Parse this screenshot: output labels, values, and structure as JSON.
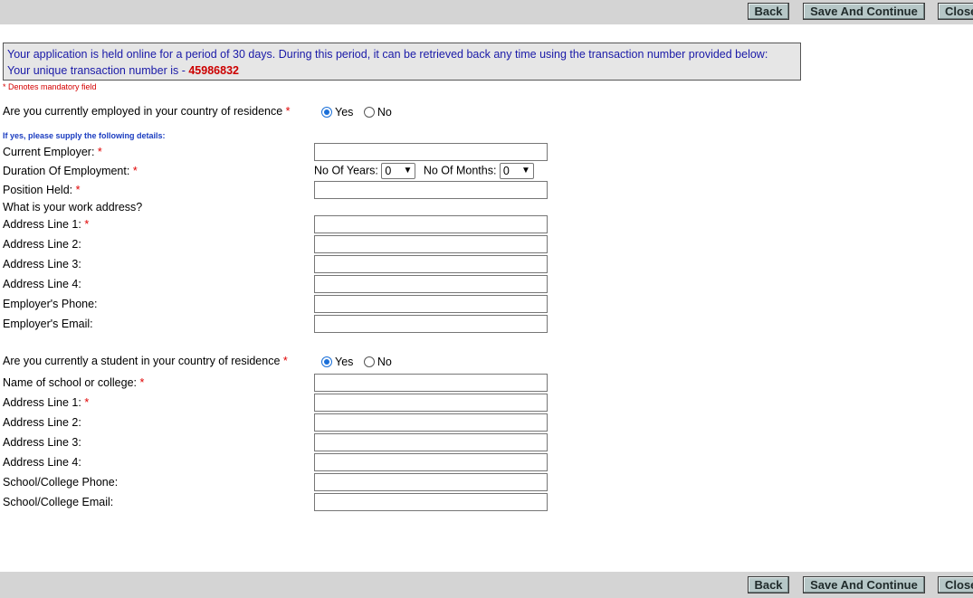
{
  "toolbar": {
    "back_label": "Back",
    "save_label": "Save And Continue",
    "close_label": "Close"
  },
  "notice": {
    "line1": "Your application is held online for a period of 30 days. During this period, it can be retrieved back any time using the transaction number provided below:",
    "line2_prefix": "Your unique transaction number is - ",
    "transaction_number": "45986832"
  },
  "mandatory_note": "* Denotes mandatory field",
  "employment": {
    "question": "Are you currently employed in your country of residence",
    "options": {
      "yes": "Yes",
      "no": "No"
    },
    "selected": "Yes",
    "hint": "If yes, please supply the following details:",
    "labels": {
      "current_employer": "Current Employer:",
      "duration": "Duration Of Employment:",
      "position": "Position Held:",
      "work_address_q": "What is your work address?",
      "addr1": "Address Line 1:",
      "addr2": "Address Line 2:",
      "addr3": "Address Line 3:",
      "addr4": "Address Line 4:",
      "phone": "Employer's Phone:",
      "email": "Employer's Email:"
    },
    "duration": {
      "years_label": "No Of Years:",
      "years_value": "0",
      "months_label": "No Of Months:",
      "months_value": "0"
    }
  },
  "student": {
    "question": "Are you currently a student in your country of residence",
    "options": {
      "yes": "Yes",
      "no": "No"
    },
    "selected": "Yes",
    "labels": {
      "school": "Name of school or college:",
      "addr1": "Address Line 1:",
      "addr2": "Address Line 2:",
      "addr3": "Address Line 3:",
      "addr4": "Address Line 4:",
      "phone": "School/College Phone:",
      "email": "School/College Email:"
    }
  },
  "required_marker": "*"
}
